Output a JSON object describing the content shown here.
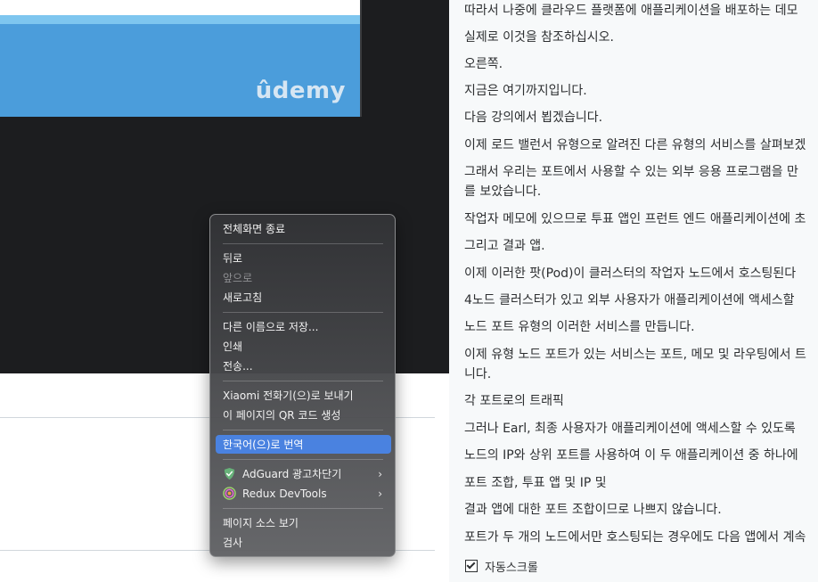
{
  "video": {
    "logo_text": "ûdemy"
  },
  "transcript": {
    "lines": [
      "따라서 나중에 클라우드 플랫폼에 애플리케이션을 배포하는 데모",
      "실제로 이것을 참조하십시오.",
      "오른쪽.",
      "지금은 여기까지입니다.",
      "다음 강의에서 뵙겠습니다.",
      "이제 로드 밸런서 유형으로 알려진 다른 유형의 서비스를 살펴보겠",
      "그래서 우리는 포트에서 사용할 수 있는 외부 응용 프로그램을 만",
      "를 보았습니다.",
      "작업자 메모에 있으므로 투표 앱인 프런트 엔드 애플리케이션에 초",
      "그리고 결과 앱.",
      "이제 이러한 팟(Pod)이 클러스터의 작업자 노드에서 호스팅된다",
      "4노드 클러스터가 있고 외부 사용자가 애플리케이션에 액세스할",
      "노드 포트 유형의 이러한 서비스를 만듭니다.",
      "이제 유형 노드 포트가 있는 서비스는 포트, 메모 및 라우팅에서 트",
      "니다.",
      "각 포트로의 트래픽",
      "그러나 Earl, 최종 사용자가 애플리케이션에 액세스할 수 있도록",
      "노드의 IP와 상위 포트를 사용하여 이 두 애플리케이션 중 하나에",
      "포트 조합, 투표 앱 및 IP 및",
      "결과 앱에 대한 포트 조합이므로 나쁘지 않습니다.",
      "포트가 두 개의 노드에서만 호스팅되는 경우에도 다음 앱에서 계속"
    ],
    "autoscroll_label": "자동스크롤",
    "autoscroll_checked": true
  },
  "context_menu": {
    "exit_fullscreen": "전체화면 종료",
    "back": "뒤로",
    "forward": "앞으로",
    "reload": "새로고침",
    "save_as": "다른 이름으로 저장...",
    "print": "인쇄",
    "cast": "전송...",
    "send_to_device": "Xiaomi 전화기(으)로 보내기",
    "qr_code": "이 페이지의 QR 코드 생성",
    "translate": "한국어(으)로 번역",
    "adguard": "AdGuard 광고차단기",
    "redux": "Redux DevTools",
    "view_source": "페이지 소스 보기",
    "inspect": "검사",
    "submenu_arrow": "›"
  },
  "colors": {
    "highlight": "#4a82e0",
    "video_bg": "#1c1d1f",
    "slide_blue": "#4b9ddb",
    "transcript_bg": "#f7f9fa"
  },
  "icons": {
    "adguard": "adguard-shield-icon",
    "redux": "redux-devtools-icon",
    "checkbox": "checkmark-icon"
  }
}
